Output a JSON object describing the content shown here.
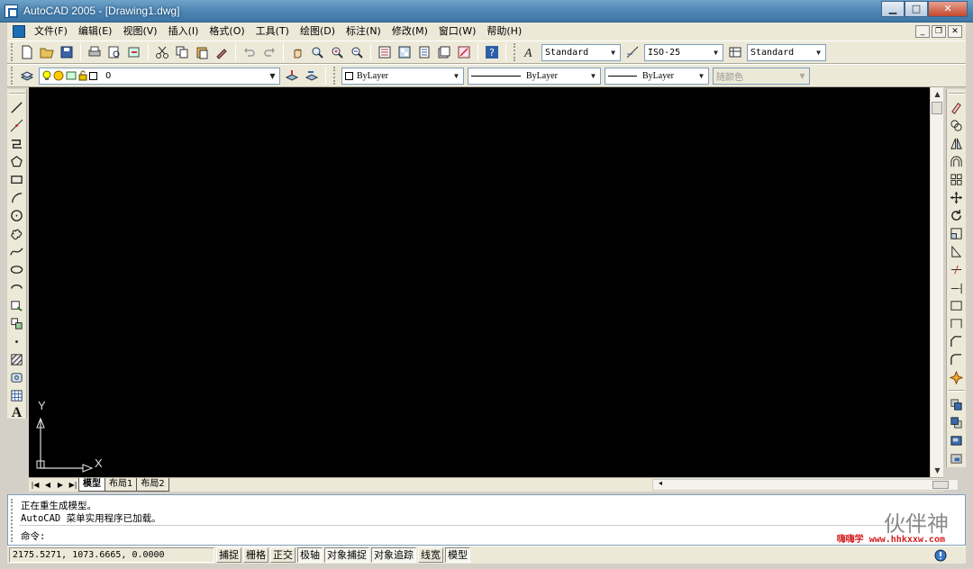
{
  "window": {
    "title": "AutoCAD 2005 - [Drawing1.dwg]",
    "minimize": "▁",
    "maximize": "□",
    "close": "✕"
  },
  "menubar": {
    "items": [
      "文件(F)",
      "编辑(E)",
      "视图(V)",
      "插入(I)",
      "格式(O)",
      "工具(T)",
      "绘图(D)",
      "标注(N)",
      "修改(M)",
      "窗口(W)",
      "帮助(H)"
    ],
    "mdi_min": "_",
    "mdi_restore": "❐",
    "mdi_close": "✕"
  },
  "styles_toolbar": {
    "text_style": "Standard",
    "dim_style": "ISO-25",
    "table_style": "Standard"
  },
  "layers_toolbar": {
    "current_layer": "0"
  },
  "properties_toolbar": {
    "color": "ByLayer",
    "linetype": "ByLayer",
    "lineweight": "ByLayer",
    "plot_style": "随颜色"
  },
  "ucs": {
    "x_label": "X",
    "y_label": "Y"
  },
  "tabs": {
    "items": [
      "模型",
      "布局1",
      "布局2"
    ],
    "active": "模型"
  },
  "command": {
    "history": [
      "正在重生成模型。",
      "AutoCAD 菜单实用程序已加载。"
    ],
    "prompt": "命令:"
  },
  "watermark": {
    "text": "伙伴神",
    "url": "嗨嗨学 www.hhkxxw.com"
  },
  "status": {
    "coordinates": "2175.5271, 1073.6665, 0.0000",
    "buttons": [
      "捕捉",
      "栅格",
      "正交",
      "极轴",
      "对象捕捉",
      "对象追踪",
      "线宽",
      "模型"
    ],
    "pressed": [
      "极轴",
      "对象捕捉",
      "对象追踪",
      "模型"
    ]
  },
  "colors": {
    "canvas": "#000000",
    "chrome": "#ece9d8",
    "titlebar": "#4f86b3"
  }
}
